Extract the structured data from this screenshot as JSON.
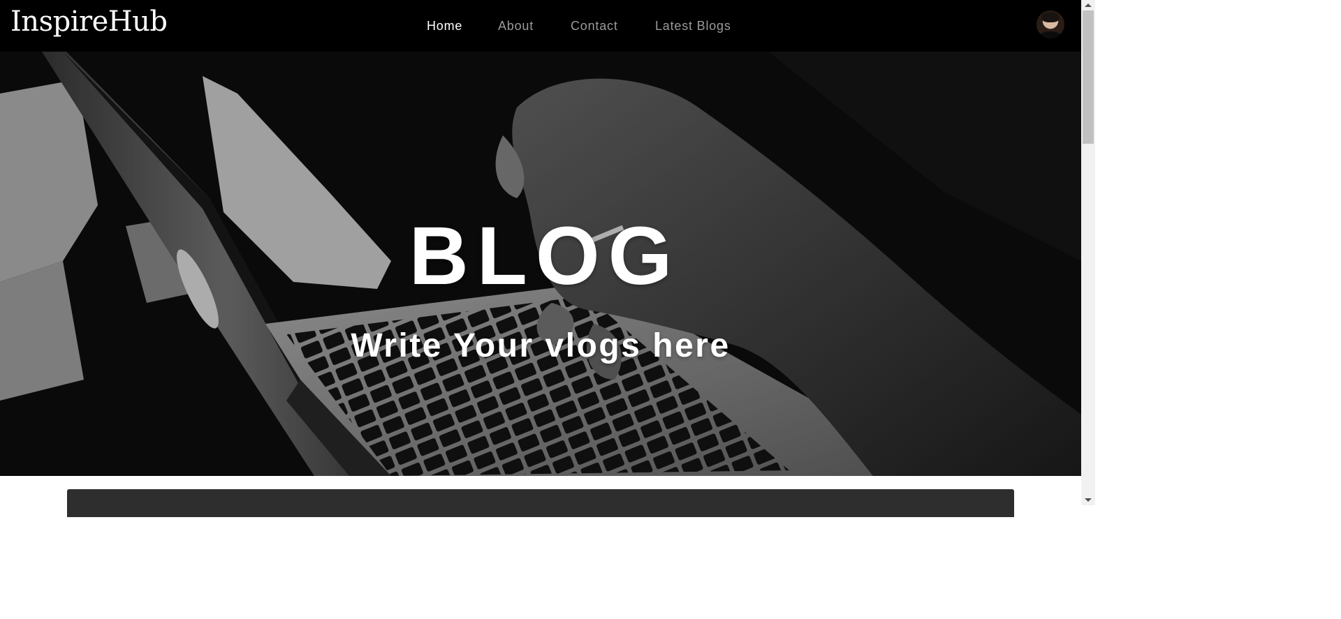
{
  "navbar": {
    "brand": "InspireHub",
    "links": [
      {
        "label": "Home",
        "active": true
      },
      {
        "label": "About",
        "active": false
      },
      {
        "label": "Contact",
        "active": false
      },
      {
        "label": "Latest Blogs",
        "active": false
      }
    ],
    "avatar_icon": "user-avatar-icon"
  },
  "hero": {
    "title": "BLOG",
    "subtitle": "Write Your vlogs here",
    "background": "black-and-white photo of hands typing on a laptop"
  },
  "colors": {
    "navbar_bg": "#000000",
    "nav_active": "#ffffff",
    "nav_inactive": "#9a9a9a",
    "hero_text": "#ffffff",
    "card_bg": "#2e2e2e"
  }
}
